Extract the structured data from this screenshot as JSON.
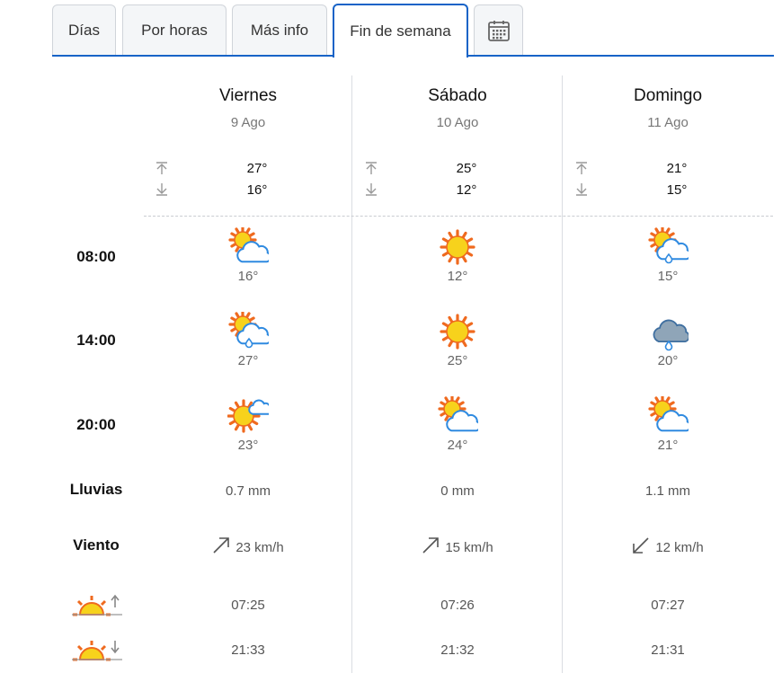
{
  "tabs": [
    {
      "label": "Días",
      "active": false
    },
    {
      "label": "Por horas",
      "active": false
    },
    {
      "label": "Más info",
      "active": false
    },
    {
      "label": "Fin de semana",
      "active": true
    },
    {
      "label": "",
      "icon": "calendar-icon",
      "active": false
    }
  ],
  "days": [
    {
      "name": "Viernes",
      "date": "9 Ago",
      "max": "27°",
      "min": "16°",
      "hours": [
        {
          "icon": "sun-cloud-icon",
          "temp": "16°"
        },
        {
          "icon": "sun-cloud-rain-icon",
          "temp": "27°"
        },
        {
          "icon": "sun-small-cloud-icon",
          "temp": "23°"
        }
      ],
      "rain": "0.7 mm",
      "wind": "23 km/h",
      "wind_dir": "northeast",
      "sunrise": "07:25",
      "sunset": "21:33"
    },
    {
      "name": "Sábado",
      "date": "10 Ago",
      "max": "25°",
      "min": "12°",
      "hours": [
        {
          "icon": "sun-icon",
          "temp": "12°"
        },
        {
          "icon": "sun-icon",
          "temp": "25°"
        },
        {
          "icon": "sun-cloud-icon",
          "temp": "24°"
        }
      ],
      "rain": "0 mm",
      "wind": "15 km/h",
      "wind_dir": "northeast",
      "sunrise": "07:26",
      "sunset": "21:32"
    },
    {
      "name": "Domingo",
      "date": "11 Ago",
      "max": "21°",
      "min": "15°",
      "hours": [
        {
          "icon": "sun-cloud-rain-icon",
          "temp": "15°"
        },
        {
          "icon": "cloud-rain-icon",
          "temp": "20°"
        },
        {
          "icon": "sun-cloud-icon",
          "temp": "21°"
        }
      ],
      "rain": "1.1 mm",
      "wind": "12 km/h",
      "wind_dir": "southwest",
      "sunrise": "07:27",
      "sunset": "21:31"
    }
  ],
  "row_labels": {
    "h1": "08:00",
    "h2": "14:00",
    "h3": "20:00",
    "rain": "Lluvias",
    "wind": "Viento"
  },
  "row_icons": {
    "sunrise": "sunrise-icon",
    "sunset": "sunset-icon"
  },
  "colors": {
    "accent": "#1763c7",
    "sun": "#f7d21c",
    "sun_rays": "#ef6a1f",
    "cloud_stroke": "#2f8ae0",
    "storm_cloud": "#8fa5b8"
  }
}
